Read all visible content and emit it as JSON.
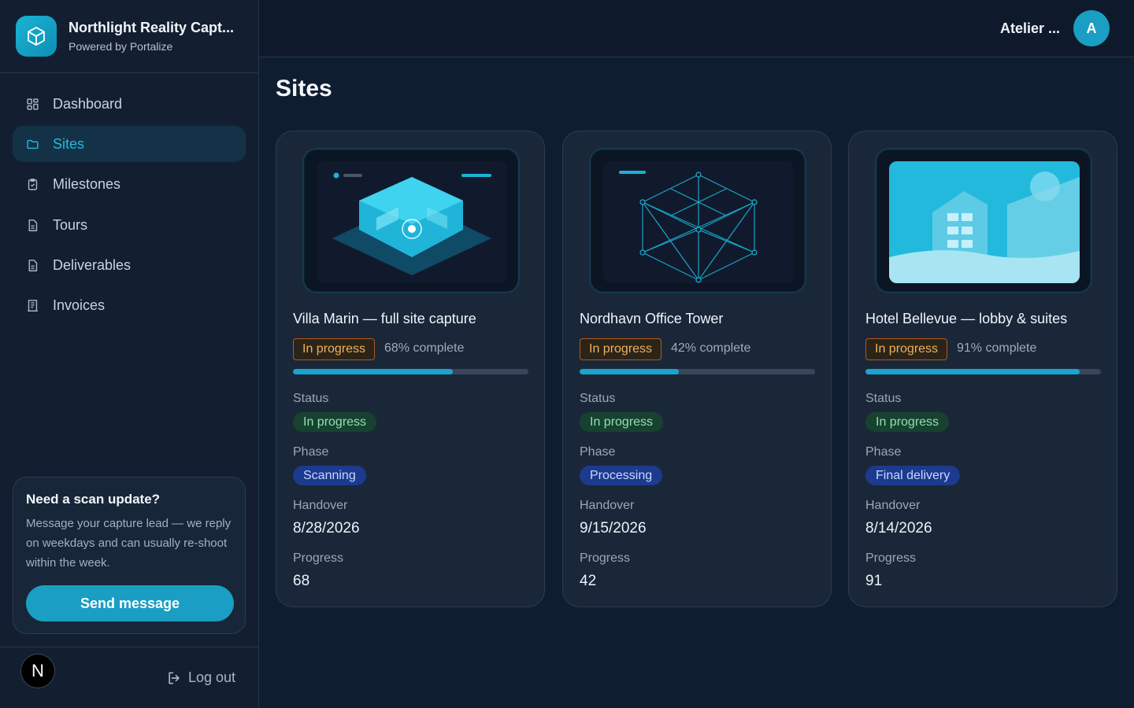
{
  "brand": {
    "name": "Northlight Reality Capt...",
    "subtitle": "Powered by Portalize",
    "logo_icon": "cube-icon"
  },
  "sidebar": {
    "items": [
      {
        "label": "Dashboard",
        "icon": "dashboard-icon",
        "active": false
      },
      {
        "label": "Sites",
        "icon": "folder-icon",
        "active": true
      },
      {
        "label": "Milestones",
        "icon": "clipboard-icon",
        "active": false
      },
      {
        "label": "Tours",
        "icon": "document-icon",
        "active": false
      },
      {
        "label": "Deliverables",
        "icon": "document-icon",
        "active": false
      },
      {
        "label": "Invoices",
        "icon": "receipt-icon",
        "active": false
      }
    ],
    "help": {
      "title": "Need a scan update?",
      "body": "Message your capture lead — we reply on weekdays and can usually re-shoot within the week.",
      "button": "Send message"
    },
    "footer": {
      "avatar_letter": "N",
      "logout": "Log out"
    }
  },
  "topbar": {
    "org": "Atelier ...",
    "avatar_letter": "A"
  },
  "main": {
    "title": "Sites",
    "labels": {
      "status": "Status",
      "phase": "Phase",
      "handover": "Handover",
      "progress": "Progress"
    },
    "sites": [
      {
        "title": "Villa Marin — full site capture",
        "tag": "In progress",
        "percent_text": "68% complete",
        "progress": 68,
        "status": "In progress",
        "phase": "Scanning",
        "handover": "8/28/2026",
        "progress_value": "68",
        "thumbnail": "3d-scan-illustration"
      },
      {
        "title": "Nordhavn Office Tower",
        "tag": "In progress",
        "percent_text": "42% complete",
        "progress": 42,
        "status": "In progress",
        "phase": "Processing",
        "handover": "9/15/2026",
        "progress_value": "42",
        "thumbnail": "wireframe-illustration"
      },
      {
        "title": "Hotel Bellevue — lobby & suites",
        "tag": "In progress",
        "percent_text": "91% complete",
        "progress": 91,
        "status": "In progress",
        "phase": "Final delivery",
        "handover": "8/14/2026",
        "progress_value": "91",
        "thumbnail": "building-landscape-illustration"
      }
    ]
  },
  "colors": {
    "accent": "#1a9ec4",
    "sidebar_bg": "#131f31",
    "main_bg": "#0f1d30",
    "status_green": "#8fe0b0",
    "phase_blue": "#1c3a8e",
    "tag_orange": "#f0b05a"
  }
}
